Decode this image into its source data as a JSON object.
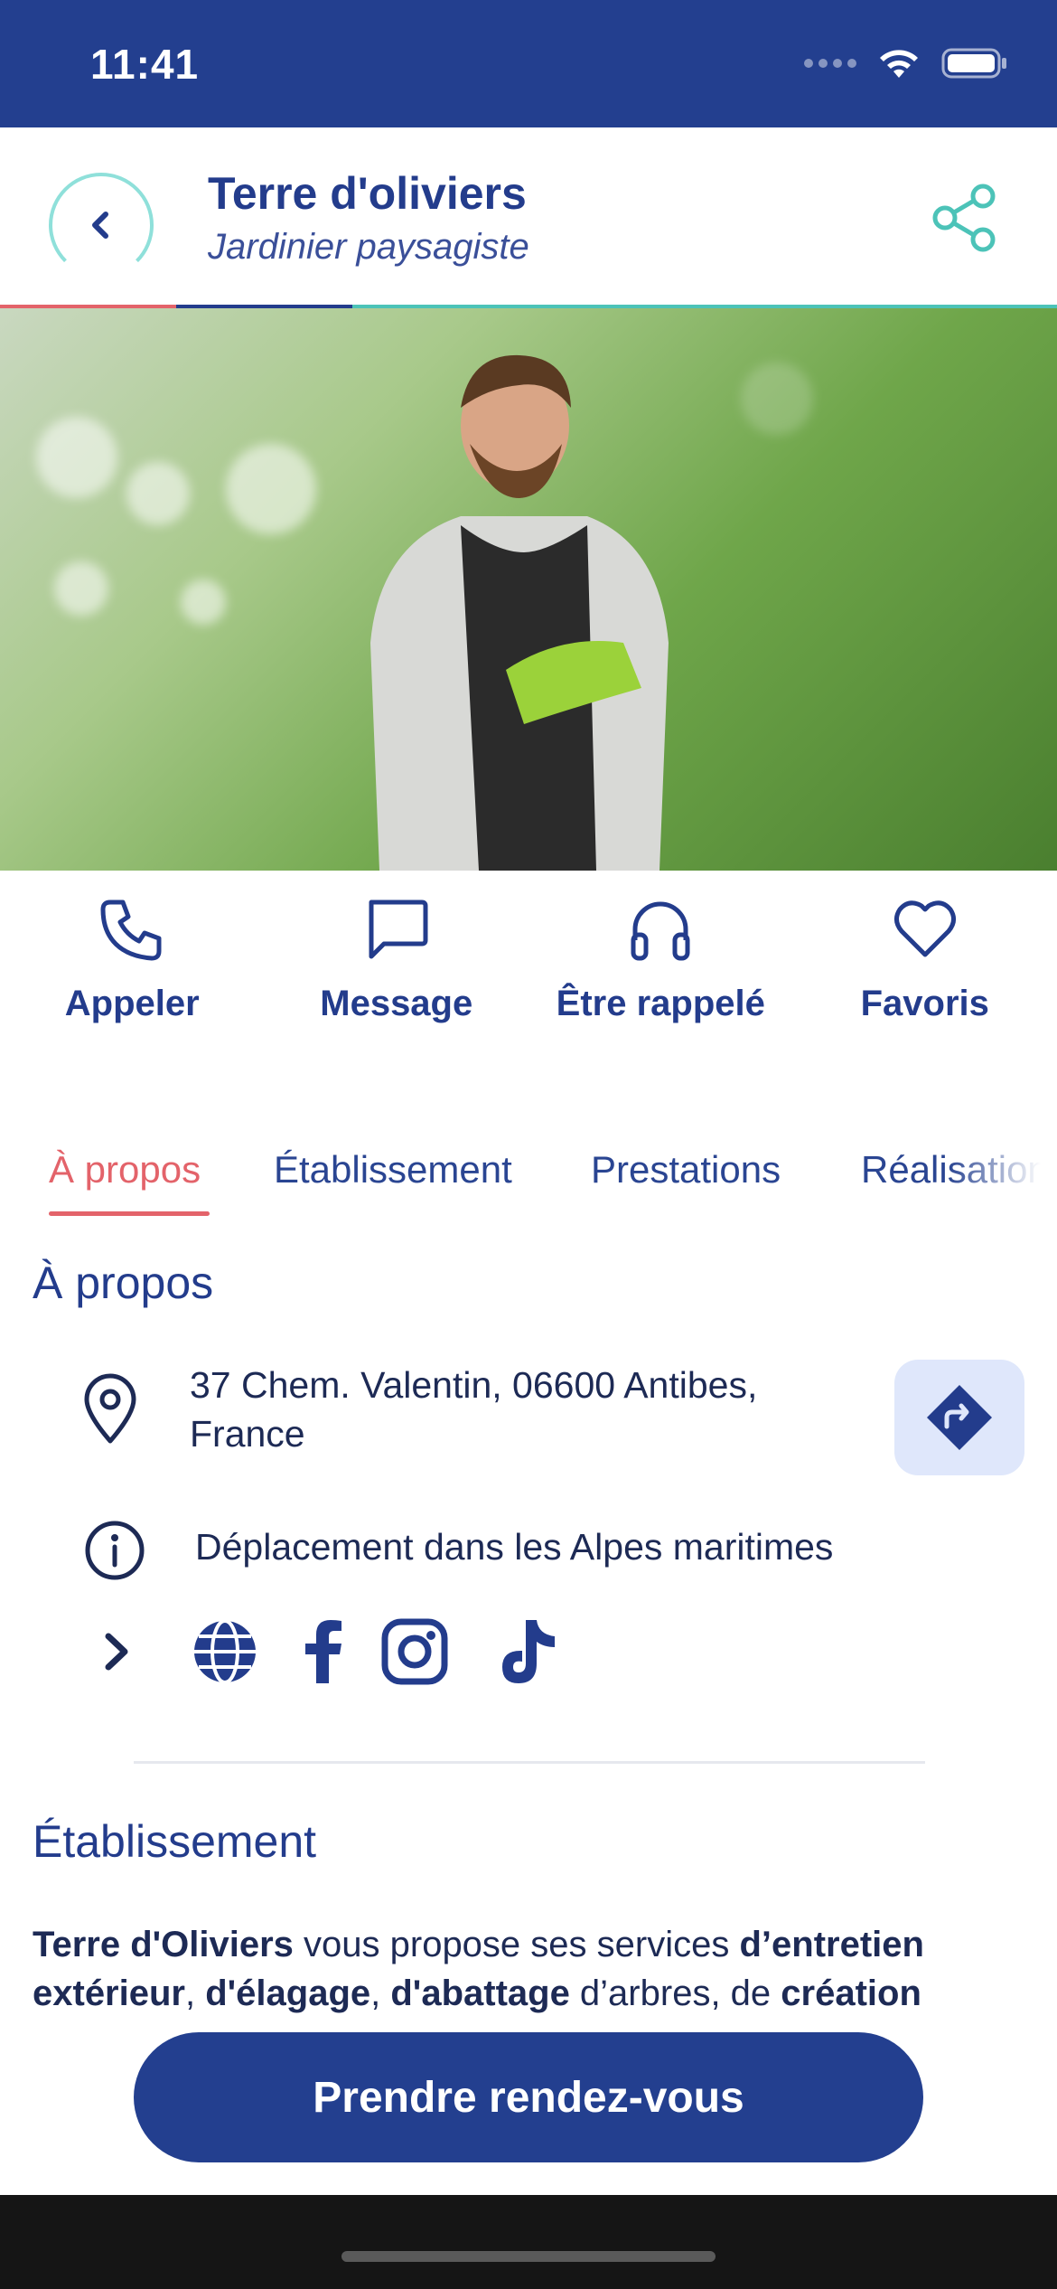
{
  "status_bar": {
    "time": "11:41"
  },
  "header": {
    "title": "Terre d'oliviers",
    "subtitle": "Jardinier paysagiste"
  },
  "actions": [
    {
      "label": "Appeler",
      "icon": "phone-icon"
    },
    {
      "label": "Message",
      "icon": "message-icon"
    },
    {
      "label": "Être rappelé",
      "icon": "headphones-icon"
    },
    {
      "label": "Favoris",
      "icon": "heart-icon"
    }
  ],
  "tabs": [
    {
      "label": "À propos",
      "active": true
    },
    {
      "label": "Établissement",
      "active": false
    },
    {
      "label": "Prestations",
      "active": false
    },
    {
      "label": "Réalisations",
      "active": false
    }
  ],
  "about": {
    "title": "À propos",
    "address_line1": "37 Chem. Valentin, 06600 Antibes,",
    "address_line2": "France",
    "travel": "Déplacement dans les Alpes maritimes",
    "socials": [
      "globe-icon",
      "facebook-icon",
      "instagram-icon",
      "tiktok-icon"
    ]
  },
  "establishment": {
    "title": "Établissement",
    "desc_1": "Terre d'Oliviers",
    "desc_2": " vous propose ses services ",
    "desc_3": "d’entretien extérieur",
    "desc_4": ", ",
    "desc_5": "d'élagage",
    "desc_6": ", ",
    "desc_7": "d'abattage",
    "desc_8": " d’arbres, de ",
    "desc_9": "création"
  },
  "cta": {
    "label": "Prendre rendez-vous"
  },
  "colors": {
    "primary": "#233f8f",
    "accent_red": "#e3636a",
    "accent_teal": "#4cc3b8",
    "route_bg": "#dfe7fb"
  }
}
